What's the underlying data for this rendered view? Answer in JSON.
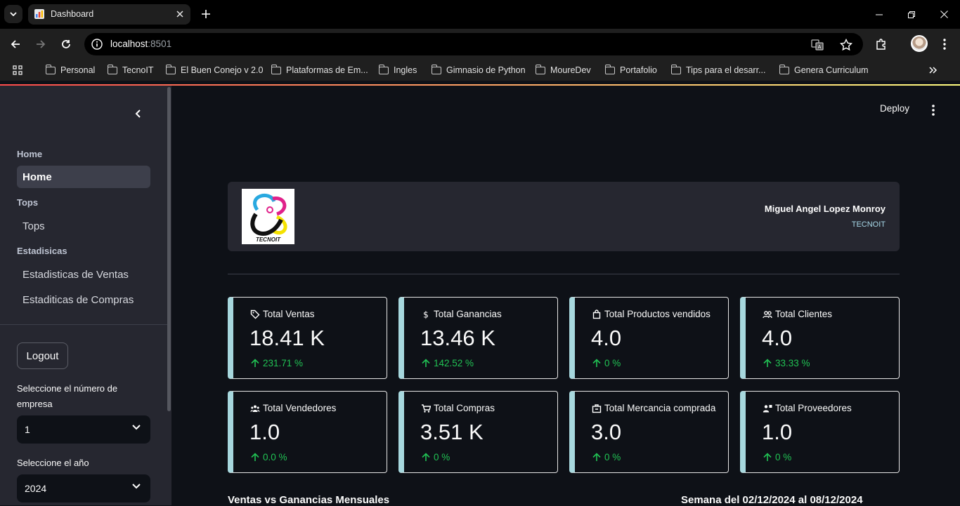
{
  "browser": {
    "tab_title": "Dashboard",
    "url_host": "localhost",
    "url_port": ":8501",
    "bookmarks": [
      "Personal",
      "TecnoIT",
      "El Buen Conejo v 2.0",
      "Plataformas de Em...",
      "Ingles",
      "Gimnasio de Python",
      "MoureDev",
      "Portafolio",
      "Tips para el desarr...",
      "Genera Curriculum"
    ]
  },
  "sidebar": {
    "sections": [
      {
        "title": "Home",
        "items": [
          "Home"
        ]
      },
      {
        "title": "Tops",
        "items": [
          "Tops"
        ]
      },
      {
        "title": "Estadisicas",
        "items": [
          "Estadisticas de Ventas",
          "Estaditicas de Compras"
        ]
      }
    ],
    "logout_label": "Logout",
    "empresa_label": "Seleccione el número de empresa",
    "empresa_value": "1",
    "year_label": "Seleccione el año",
    "year_value": "2024"
  },
  "header": {
    "deploy_label": "Deploy",
    "logo_text": "TECNOIT",
    "user_name": "Miguel Angel Lopez Monroy",
    "company": "TECNOIT"
  },
  "metrics": [
    {
      "label": "Total Ventas",
      "value": "18.41 K",
      "delta": "231.71 %",
      "icon": "tag-icon"
    },
    {
      "label": "Total Ganancias",
      "value": "13.46 K",
      "delta": "142.52 %",
      "icon": "dollar-icon"
    },
    {
      "label": "Total Productos vendidos",
      "value": "4.0",
      "delta": "0 %",
      "icon": "shopping-bag-icon"
    },
    {
      "label": "Total Clientes",
      "value": "4.0",
      "delta": "33.33 %",
      "icon": "users-icon"
    },
    {
      "label": "Total Vendedores",
      "value": "1.0",
      "delta": "0.0 %",
      "icon": "group-icon"
    },
    {
      "label": "Total Compras",
      "value": "3.51 K",
      "delta": "0 %",
      "icon": "cart-icon"
    },
    {
      "label": "Total Mercancia comprada",
      "value": "3.0",
      "delta": "0 %",
      "icon": "box-icon"
    },
    {
      "label": "Total Proveedores",
      "value": "1.0",
      "delta": "0 %",
      "icon": "supplier-icon"
    }
  ],
  "sections": {
    "left_title": "Ventas vs Ganancias Mensuales",
    "right_title": "Semana del 02/12/2024 al 08/12/2024"
  },
  "colors": {
    "accent_border": "#a7d8de",
    "delta_positive": "#21c354",
    "background": "#0e1117",
    "sidebar": "#262730"
  }
}
